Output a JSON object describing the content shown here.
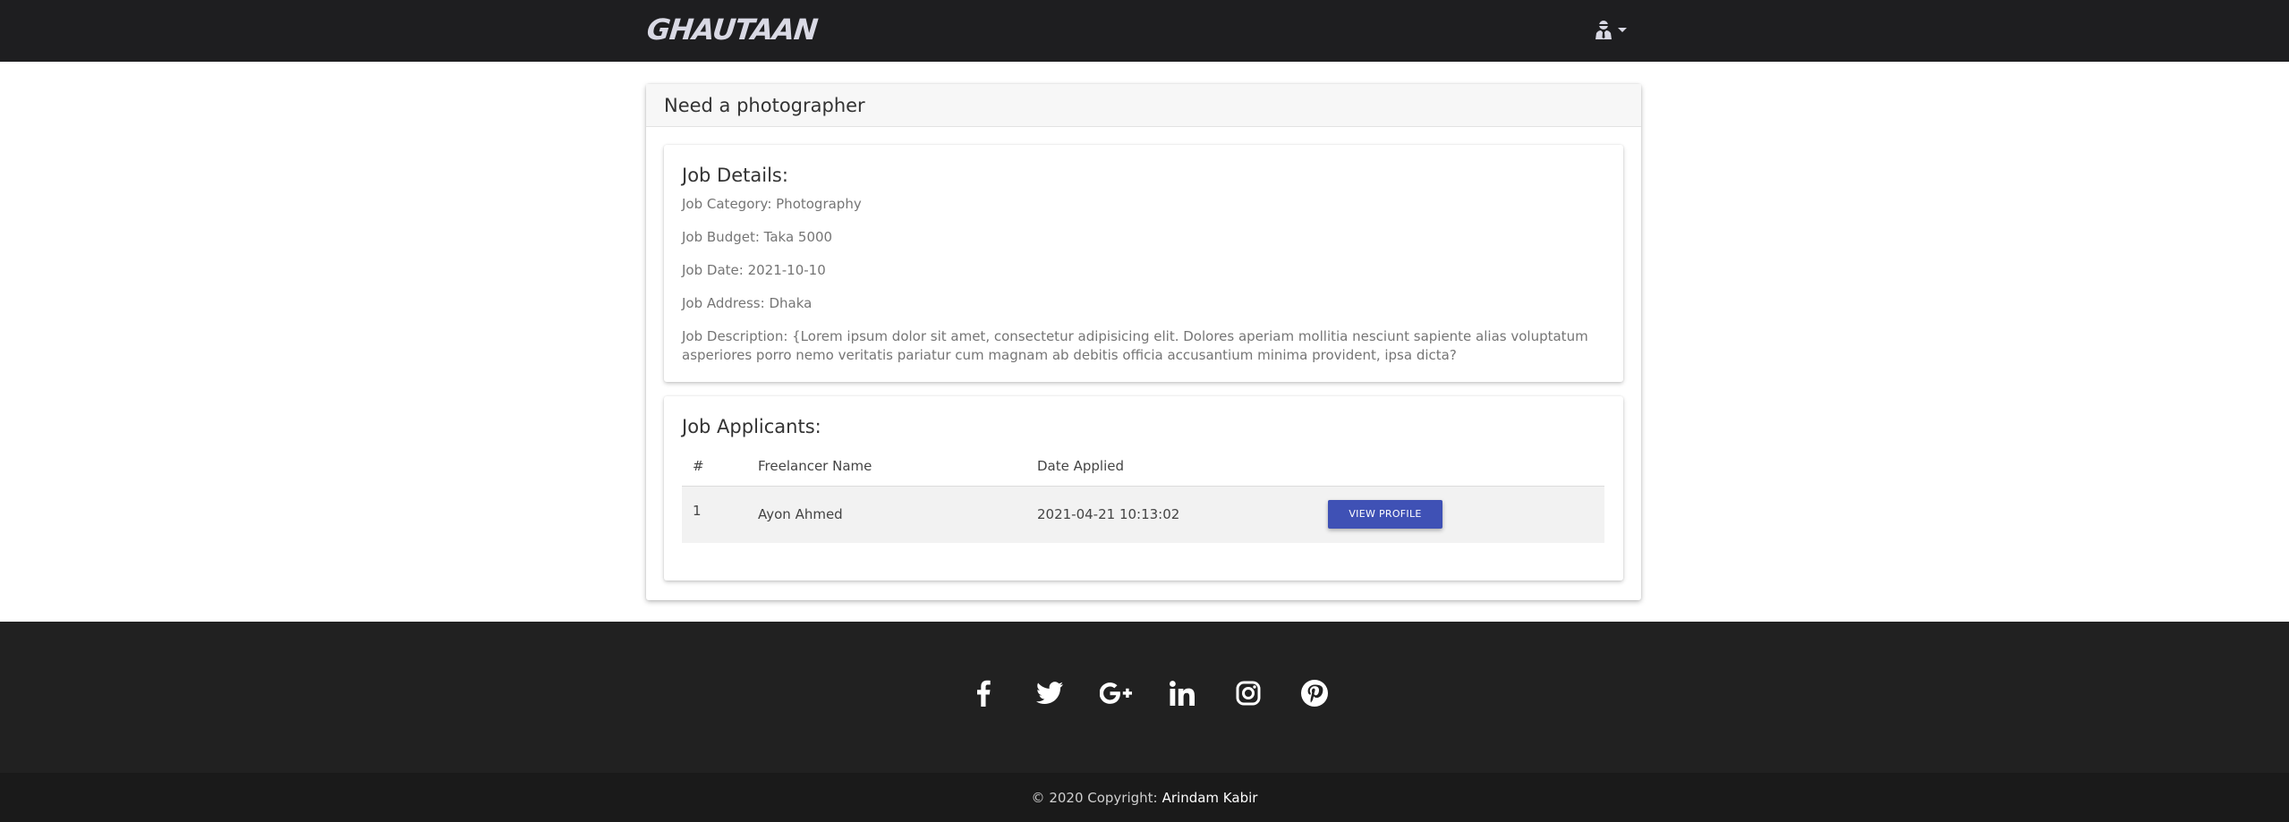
{
  "navbar": {
    "brand": "GHAUTAAN",
    "user_icon": "user-secret-icon"
  },
  "job": {
    "title": "Need a photographer",
    "details_heading": "Job Details:",
    "category": "Job Category: Photography",
    "budget": "Job Budget: Taka 5000",
    "date": "Job Date: 2021-10-10",
    "address": "Job Address: Dhaka",
    "description": "Job Description: {Lorem ipsum dolor sit amet, consectetur adipisicing elit. Dolores aperiam mollitia nesciunt sapiente alias voluptatum asperiores porro nemo veritatis pariatur cum magnam ab debitis officia accusantium minima provident, ipsa dicta?"
  },
  "applicants": {
    "heading": "Job Applicants:",
    "columns": [
      "#",
      "Freelancer Name",
      "Date Applied",
      ""
    ],
    "rows": [
      {
        "num": "1",
        "name": "Ayon Ahmed",
        "date": "2021-04-21 10:13:02",
        "action": "VIEW PROFILE"
      }
    ]
  },
  "footer": {
    "social_icons": [
      "facebook-icon",
      "twitter-icon",
      "google-plus-icon",
      "linkedin-icon",
      "instagram-icon",
      "pinterest-icon"
    ],
    "copyright_prefix": "© 2020 Copyright:",
    "copyright_author": "Arindam Kabir"
  },
  "colors": {
    "navbar_bg": "#1e1e20",
    "footer_bg": "#212121",
    "copyright_bg": "#1a1a1a",
    "button_primary": "#3f51b5"
  }
}
